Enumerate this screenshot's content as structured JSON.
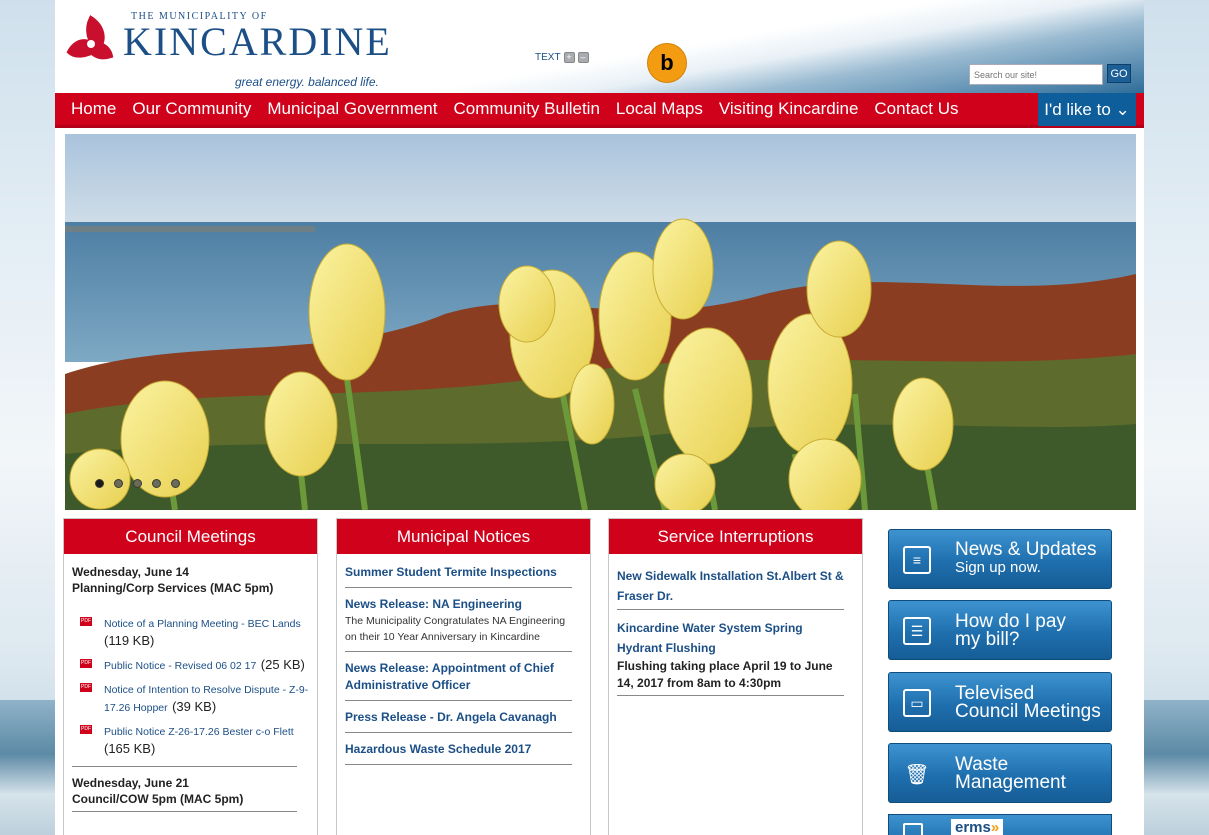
{
  "header": {
    "logo_small": "THE MUNICIPALITY OF",
    "logo_big": "KINCARDINE",
    "tagline": "great energy. balanced life.",
    "text_size_label": "TEXT",
    "text_plus": "+",
    "text_minus": "–",
    "audio_icon": "b",
    "search_placeholder": "Search our site!",
    "search_go": "GO"
  },
  "nav": {
    "items": [
      "Home",
      "Our Community",
      "Municipal Government",
      "Community Bulletin",
      "Local Maps",
      "Visiting Kincardine",
      "Contact Us"
    ],
    "cta": "I'd like to ⌄"
  },
  "hero": {
    "slides": 5,
    "active_slide": 1
  },
  "council": {
    "title": "Council Meetings",
    "meetings": [
      {
        "date": "Wednesday, June 14",
        "body": "Planning/Corp Services (MAC 5pm)",
        "docs": [
          {
            "name": "Notice of a Planning Meeting - BEC Lands",
            "size": "(119 KB)"
          },
          {
            "name": "Public Notice - Revised 06 02 17",
            "size": "(25 KB)"
          },
          {
            "name": "Notice of Intention to Resolve Dispute - Z-9-17.26 Hopper",
            "size": "(39 KB)"
          },
          {
            "name": "Public Notice Z-26-17.26 Bester c-o Flett",
            "size": "(165 KB)"
          }
        ]
      },
      {
        "date": "Wednesday, June 21",
        "body": "Council/COW 5pm (MAC 5pm)"
      }
    ],
    "pdf_label": "PDF"
  },
  "notices": {
    "title": "Municipal Notices",
    "items": [
      {
        "title": "Summer Student Termite Inspections",
        "desc": ""
      },
      {
        "title": "News Release: NA Engineering",
        "desc": "The Municipality Congratulates NA Engineering on their 10 Year Anniversary in Kincardine"
      },
      {
        "title": "News Release: Appointment of Chief Administrative Officer",
        "desc": ""
      },
      {
        "title": "Press Release - Dr. Angela Cavanagh",
        "desc": ""
      },
      {
        "title": "Hazardous Waste Schedule 2017",
        "desc": ""
      }
    ]
  },
  "interruptions": {
    "title": "Service Interruptions",
    "items": [
      {
        "title": "New Sidewalk Installation St.Albert St & Fraser Dr.",
        "desc": ""
      },
      {
        "title": "Kincardine Water System Spring Hydrant Flushing",
        "desc": "Flushing taking place April 19 to June 14, 2017 from 8am to 4:30pm"
      }
    ]
  },
  "sidebar": {
    "news_t1": "News & Updates",
    "news_t2": "Sign up now.",
    "pay_t1": "How do I pay",
    "pay_t2": "my bill?",
    "tv_t1": "Televised",
    "tv_t2": "Council Meetings",
    "waste_t1": "Waste",
    "waste_t2": "Management",
    "erms": "erms",
    "erms_arrows": "»"
  },
  "colors": {
    "brand_red": "#d0021b",
    "brand_blue": "#1c4f86",
    "button_blue": "#1f6fae"
  }
}
